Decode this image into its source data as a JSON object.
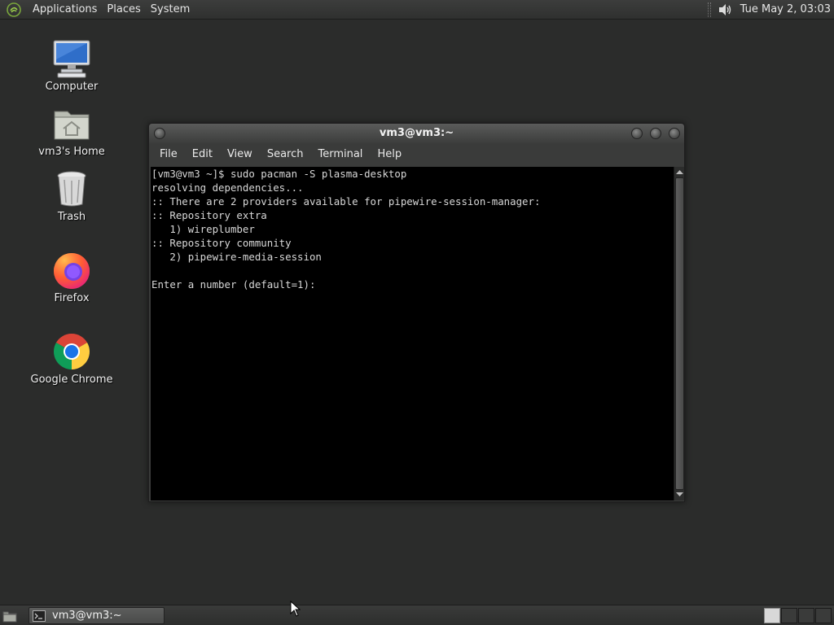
{
  "top_panel": {
    "menus": [
      "Applications",
      "Places",
      "System"
    ],
    "clock": "Tue May  2, 03:03",
    "icons": {
      "menu": "mate-logo-icon",
      "volume": "volume-icon"
    }
  },
  "desktop_icons": [
    {
      "label": "Computer",
      "icon": "computer-icon"
    },
    {
      "label": "vm3's Home",
      "icon": "home-folder-icon"
    },
    {
      "label": "Trash",
      "icon": "trash-icon"
    },
    {
      "label": "Firefox",
      "icon": "firefox-icon"
    },
    {
      "label": "Google Chrome",
      "icon": "chrome-icon"
    }
  ],
  "terminal": {
    "title": "vm3@vm3:~",
    "menu": [
      "File",
      "Edit",
      "View",
      "Search",
      "Terminal",
      "Help"
    ],
    "lines": [
      "[vm3@vm3 ~]$ sudo pacman -S plasma-desktop",
      "resolving dependencies...",
      ":: There are 2 providers available for pipewire-session-manager:",
      ":: Repository extra",
      "   1) wireplumber",
      ":: Repository community",
      "   2) pipewire-media-session",
      "",
      "Enter a number (default=1):"
    ]
  },
  "bottom_panel": {
    "task_label": "vm3@vm3:~",
    "workspaces": 4,
    "active_workspace": 1
  },
  "colors": {
    "desktop_bg": "#2b2c2b",
    "terminal_bg": "#000000",
    "terminal_fg": "#d8d8d8"
  }
}
